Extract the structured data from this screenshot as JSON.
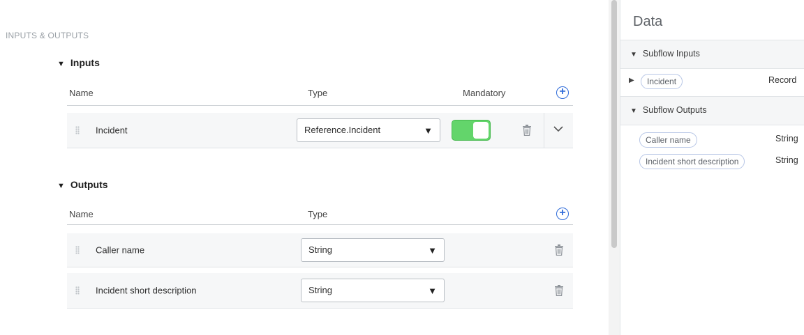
{
  "section_title": "INPUTS & OUTPUTS",
  "inputs": {
    "heading": "Inputs",
    "col_name": "Name",
    "col_type": "Type",
    "col_mandatory": "Mandatory",
    "rows": [
      {
        "name": "Incident",
        "type": "Reference.Incident",
        "mandatory": true
      }
    ]
  },
  "outputs": {
    "heading": "Outputs",
    "col_name": "Name",
    "col_type": "Type",
    "rows": [
      {
        "name": "Caller name",
        "type": "String"
      },
      {
        "name": "Incident short description",
        "type": "String"
      }
    ]
  },
  "icons": {
    "collapse": "▼",
    "expand": "▶",
    "caret": "▼",
    "plus": "+",
    "chevron": "chevron-down"
  },
  "colors": {
    "accent": "#2e6bd9",
    "toggle_on": "#63d56b"
  },
  "data_panel": {
    "title": "Data",
    "inputs_heading": "Subflow Inputs",
    "input_items": [
      {
        "label": "Incident",
        "type": "Record"
      }
    ],
    "outputs_heading": "Subflow Outputs",
    "output_items": [
      {
        "label": "Caller name",
        "type": "String"
      },
      {
        "label": "Incident short description",
        "type": "String"
      }
    ]
  }
}
